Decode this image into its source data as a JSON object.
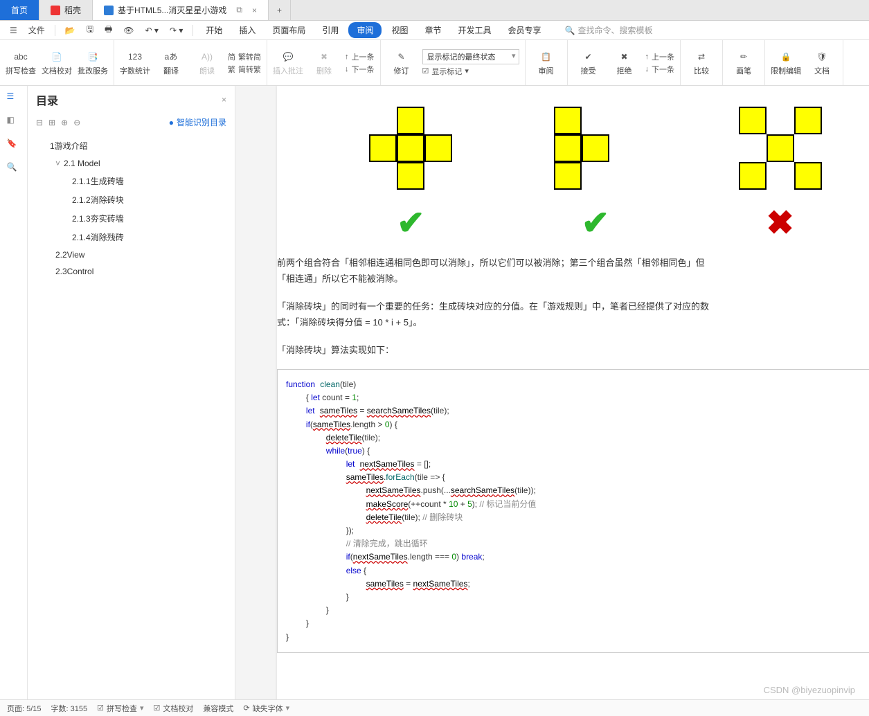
{
  "tabs": {
    "home": "首页",
    "shell": "稻壳",
    "doc": "基于HTML5...消灭星星小游戏",
    "plus": "+"
  },
  "menubar": {
    "file": "文件",
    "items": [
      "开始",
      "插入",
      "页面布局",
      "引用",
      "审阅",
      "视图",
      "章节",
      "开发工具",
      "会员专享"
    ],
    "search_placeholder": "查找命令、搜索模板"
  },
  "ribbon": {
    "spellcheck": "拼写检查",
    "proofread": "文档校对",
    "batch": "批改服务",
    "wordcount": "字数统计",
    "translate": "翻译",
    "read": "朗读",
    "simp": "繁转简",
    "trad": "简转繁",
    "comment": "插入批注",
    "delete": "删除",
    "prev_c": "上一条",
    "next_c": "下一条",
    "revise": "修订",
    "display_sel": "显示标记的最终状态",
    "show_marks": "显示标记",
    "review": "审阅",
    "accept": "接受",
    "reject": "拒绝",
    "rprev": "上一条",
    "rnext": "下一条",
    "compare": "比较",
    "pen": "画笔",
    "restrict": "限制编辑",
    "protect": "文档"
  },
  "outline": {
    "title": "目录",
    "smart": "智能识别目录",
    "items": [
      {
        "lvl": 1,
        "text": "1游戏介绍"
      },
      {
        "lvl": 2,
        "text": "2.1 Model",
        "expanded": true
      },
      {
        "lvl": 3,
        "text": "2.1.1生成砖墙"
      },
      {
        "lvl": 3,
        "text": "2.1.2消除砖块"
      },
      {
        "lvl": 3,
        "text": "2.1.3夯实砖墙"
      },
      {
        "lvl": 3,
        "text": "2.1.4消除残砖"
      },
      {
        "lvl": 2,
        "text": "2.2View"
      },
      {
        "lvl": 2,
        "text": "2.3Control"
      }
    ]
  },
  "doc": {
    "p1": "前两个组合符合「相邻相连通相同色即可以消除」，所以它们可以被消除；第三个组合虽然「相邻相同色」但",
    "p1b": "「相连通」所以它不能被消除。",
    "p2": "「消除砖块」的同时有一个重要的任务：生成砖块对应的分值。在「游戏规则」中，笔者已经提供了对应的数",
    "p2b": "式：「消除砖块得分值 = 10 * i + 5」。",
    "p3": "「消除砖块」算法实现如下：",
    "code": {
      "l1a": "function",
      "l1b": "clean",
      "l1c": "(tile)",
      "l2a": "{ ",
      "l2b": "let",
      "l2c": " count = ",
      "l2d": "1",
      "l2e": ";",
      "l3a": "let",
      "l3b": "sameTiles",
      "l3c": " = ",
      "l3d": "searchSameTiles",
      "l3e": "(tile);",
      "l4a": "if",
      "l4b": "(",
      "l4c": "sameTiles",
      "l4d": ".length > ",
      "l4e": "0",
      "l4f": ") {",
      "l5a": "deleteTile",
      "l5b": "(tile);",
      "l6a": "while",
      "l6b": "(",
      "l6c": "true",
      "l6d": ") {",
      "l7a": "let",
      "l7b": "nextSameTiles",
      "l7c": " = [];",
      "l8a": "sameTiles",
      "l8b": ".",
      "l8c": "forEach",
      "l8d": "(tile => {",
      "l9a": "nextSameTiles",
      "l9b": ".push(...",
      "l9c": "searchSameTiles",
      "l9d": "(tile));",
      "l10a": "makeScore",
      "l10b": "(++count * ",
      "l10c": "10",
      "l10d": " + ",
      "l10e": "5",
      "l10f": "); ",
      "l10g": "// 标记当前分值",
      "l11a": "deleteTile",
      "l11b": "(tile); ",
      "l11c": "// 删除砖块",
      "l12": "});",
      "l13": "// 清除完成，跳出循环",
      "l14a": "if",
      "l14b": "(",
      "l14c": "nextSameTiles",
      "l14d": ".length === ",
      "l14e": "0",
      "l14f": ") ",
      "l14g": "break",
      "l14h": ";",
      "l15a": "else",
      "l15b": " {",
      "l16a": "sameTiles",
      "l16b": " = ",
      "l16c": "nextSameTiles",
      "l16d": ";",
      "l17": "}",
      "l18": "}",
      "l19": "}",
      "l20": "}"
    }
  },
  "status": {
    "page": "页面: 5/15",
    "words": "字数: 3155",
    "spell": "拼写检查",
    "proof": "文档校对",
    "compat": "兼容模式",
    "recover": "缺失字体"
  },
  "watermark": "CSDN @biyezuopinvip"
}
